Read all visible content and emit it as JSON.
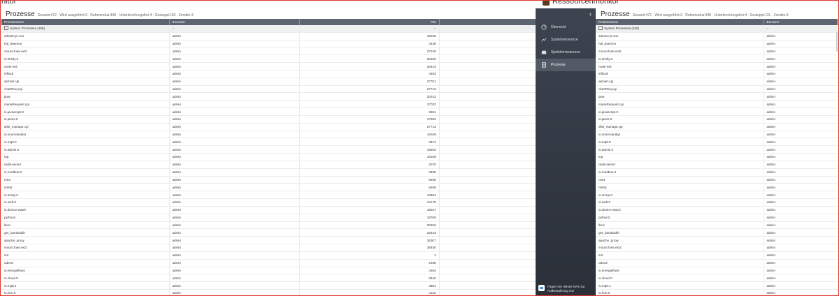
{
  "left_window": {
    "title": "nitor",
    "header": {
      "title": "Prozesse",
      "stats": "Gesamt:472 · Wird ausgeführt:3 · Ruhemodus:348 · Unterbrechungsfrei:4 · Gestoppt:115 · Zombie:3"
    },
    "columns": [
      "Prozessname",
      "Benutzer",
      "PID"
    ],
    "group_row": {
      "name": "System Prozesses (165)",
      "user": "--",
      "pid": "--"
    }
  },
  "right_window": {
    "title": "Ressourcenmonitor",
    "header": {
      "title": "Prozesse",
      "stats": "Gesamt:472 · Wird ausgeführt:3 · Ruhemodus:348 · Unterbrechungsfrei:4 · Gestoppt:115 · Zombie:3"
    },
    "columns": [
      "Prozessname",
      "Benutzer"
    ],
    "group_row": {
      "name": "System Prozesses (165)",
      "user": "--"
    }
  },
  "sidebar": {
    "collapse_icon": "chevron-left-icon",
    "items": [
      {
        "label": "Übersicht",
        "icon": "dashboard-icon",
        "active": false
      },
      {
        "label": "Systemressource",
        "icon": "line-chart-icon",
        "active": false
      },
      {
        "label": "Speicherressource",
        "icon": "storage-icon",
        "active": false
      },
      {
        "label": "Prozesse",
        "icon": "document-icon",
        "active": true
      }
    ],
    "promo": "Fügen Sie dieses NAS zur Aufbewahrung von"
  },
  "processes": [
    {
      "name": "sdnotvr.js-coo",
      "user": "admin",
      "pid": "16045"
    },
    {
      "name": "hal_daemon",
      "user": "admin",
      "pid": "3435"
    },
    {
      "name": "mount.fuse.ext2",
      "user": "admin",
      "pid": "27226"
    },
    {
      "name": "io.shelly.0",
      "user": "admin",
      "pid": "25460"
    },
    {
      "name": "node-red",
      "user": "admin",
      "pid": "26424"
    },
    {
      "name": "influxd",
      "user": "admin",
      "pid": "4453"
    },
    {
      "name": "qsmart.cgi",
      "user": "admin",
      "pid": "27701"
    },
    {
      "name": "chartReq.cgi",
      "user": "admin",
      "pid": "27712"
    },
    {
      "name": "java",
      "user": "admin",
      "pid": "20012"
    },
    {
      "name": "manaRequest.cgi",
      "user": "admin",
      "pid": "27702"
    },
    {
      "name": "io.javascript.0",
      "user": "admin",
      "pid": "3681"
    },
    {
      "name": "io.jarvis.0",
      "user": "admin",
      "pid": "17802"
    },
    {
      "name": "disk_manage.cgi",
      "user": "admin",
      "pid": "27713"
    },
    {
      "name": "io.sourceanalyt",
      "user": "admin",
      "pid": "14049"
    },
    {
      "name": "io.mqtt.0",
      "user": "admin",
      "pid": "3871"
    },
    {
      "name": "io.admin.0",
      "user": "admin",
      "pid": "16692"
    },
    {
      "name": "top",
      "user": "admin",
      "pid": "19159"
    },
    {
      "name": "redis-server",
      "user": "admin",
      "pid": "2070"
    },
    {
      "name": "io.modbus.0",
      "user": "admin",
      "pid": "3825"
    },
    {
      "name": "nmd",
      "user": "admin",
      "pid": "8450"
    },
    {
      "name": "nmbd",
      "user": "admin",
      "pid": "8459"
    },
    {
      "name": "io.snmp.0",
      "user": "admin",
      "pid": "13961"
    },
    {
      "name": "io.web.0",
      "user": "admin",
      "pid": "14170"
    },
    {
      "name": "io.device-watch",
      "user": "admin",
      "pid": "18037"
    },
    {
      "name": "python2",
      "user": "admin",
      "pid": "19765"
    },
    {
      "name": "llvnc",
      "user": "admin",
      "pid": "20462"
    },
    {
      "name": "get_bandwidth",
      "user": "admin",
      "pid": "23434"
    },
    {
      "name": "apache_proxy",
      "user": "admin",
      "pid": "26307"
    },
    {
      "name": "mount.fuse.ext2",
      "user": "admin",
      "pid": "26840"
    },
    {
      "name": "init",
      "user": "admin",
      "pid": "1"
    },
    {
      "name": "udevd",
      "user": "admin",
      "pid": "2465"
    },
    {
      "name": "io.energiefluss",
      "user": "admin",
      "pid": "2554"
    },
    {
      "name": "io.cloud.0",
      "user": "admin",
      "pid": "2642"
    },
    {
      "name": "io.mqtt.1",
      "user": "admin",
      "pid": "3881"
    },
    {
      "name": "io.hue.0",
      "user": "admin",
      "pid": "4122"
    }
  ]
}
